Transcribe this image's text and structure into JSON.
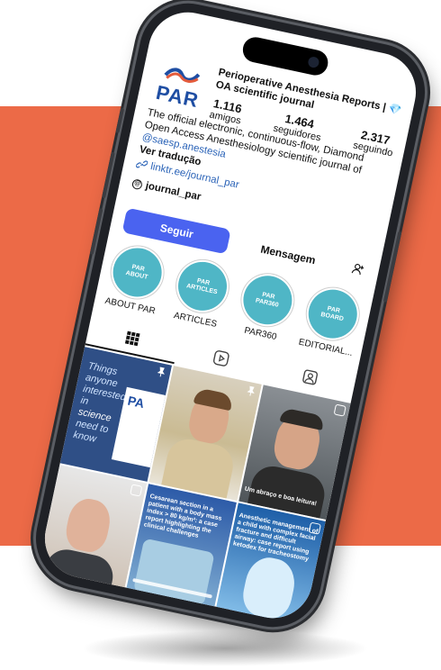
{
  "profile": {
    "name": "Perioperative Anesthesia Reports | 💎OA scientific journal",
    "logo_text": "PAR",
    "stats": [
      {
        "value": "1.116",
        "label": "amigos"
      },
      {
        "value": "1.464",
        "label": "seguidores"
      },
      {
        "value": "2.317",
        "label": "seguindo"
      }
    ],
    "bio": "The official electronic, continuous-flow, Diamond Open Access Anesthesiology scientific journal of",
    "bio_handle": "@saesp.anestesia",
    "translate": "Ver tradução",
    "link": "linktr.ee/journal_par",
    "threads": "journal_par"
  },
  "actions": {
    "follow": "Seguir",
    "message": "Mensagem"
  },
  "highlights": [
    {
      "cover_top": "PAR",
      "cover_bottom": "ABOUT",
      "name": "ABOUT PAR"
    },
    {
      "cover_top": "PAR",
      "cover_bottom": "ARTICLES",
      "name": "ARTICLES"
    },
    {
      "cover_top": "PAR",
      "cover_bottom": "PAR360",
      "name": "PAR360"
    },
    {
      "cover_top": "PAR",
      "cover_bottom": "BOARD",
      "name": "EDITORIAL..."
    }
  ],
  "posts": {
    "p1_line1": "Things anyone",
    "p1_line2": "interested in",
    "p1_line3a": "science",
    "p1_line3b": "need to",
    "p1_line4": "know",
    "p1_logo": "PA",
    "p3_caption": "Um abraço e boa leitura!",
    "p5_caption": "Cesarean section in a patient with a body mass index > 80 kg/m²: a case report highlighting the clinical challenges",
    "p6_caption": "Anesthetic management of a child with complex facial fracture and difficult airway: case report using ketodex for tracheostomy"
  },
  "colors": {
    "accent": "#4a63f0",
    "background_band": "#ec6a47",
    "highlight": "#4fb6c6",
    "link": "#2c64b8"
  }
}
